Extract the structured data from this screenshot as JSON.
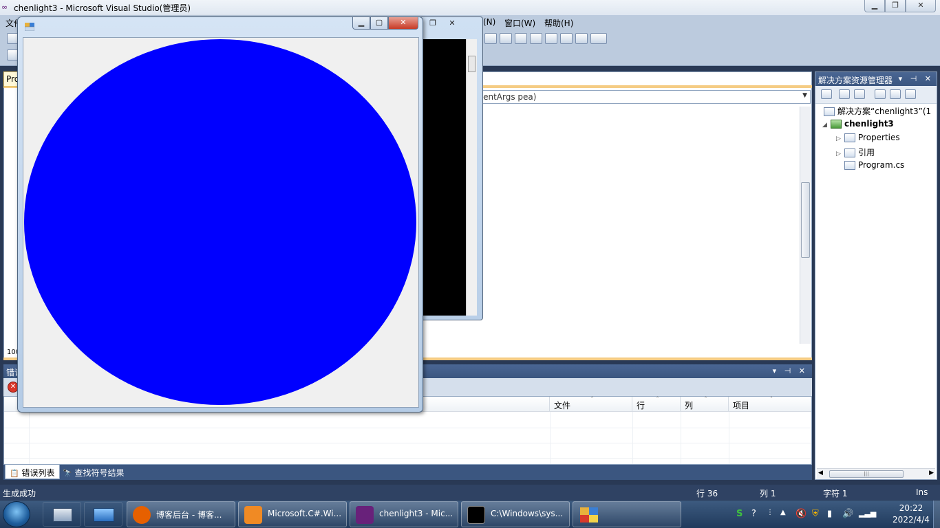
{
  "vs": {
    "title": "chenlight3 - Microsoft Visual Studio(管理员)",
    "menus": [
      "文件",
      "(N)",
      "窗口(W)",
      "帮助(H)"
    ],
    "editor": {
      "tab_label": "Pro",
      "method_dropdown": "ventArgs pea)",
      "zoom": "100"
    }
  },
  "form": {
    "circle_color": "#0000ff",
    "client_bg": "#f0f0f0"
  },
  "solution_explorer": {
    "title": "解决方案资源管理器",
    "solution": "解决方案“chenlight3”(1",
    "project": "chenlight3",
    "items": [
      "Properties",
      "引用",
      "Program.cs"
    ]
  },
  "error_list": {
    "title": "错误",
    "columns": [
      "文件",
      "行",
      "列",
      "项目"
    ]
  },
  "bottom_tabs": {
    "errors": "错误列表",
    "symbols": "查找符号结果"
  },
  "statusbar": {
    "message": "生成成功",
    "row": "行 36",
    "col": "列 1",
    "char": "字符 1",
    "mode": "Ins"
  },
  "taskbar": {
    "tasks": [
      {
        "label": "博客后台 - 博客...",
        "color": "#e66000"
      },
      {
        "label": "Microsoft.C#.Wi...",
        "color": "#f08a24"
      },
      {
        "label": "chenlight3 - Mic...",
        "color": "#68217a"
      },
      {
        "label": "C:\\Windows\\sys...",
        "color": "#000000"
      }
    ],
    "time": "20:22",
    "date": "2022/4/4"
  }
}
